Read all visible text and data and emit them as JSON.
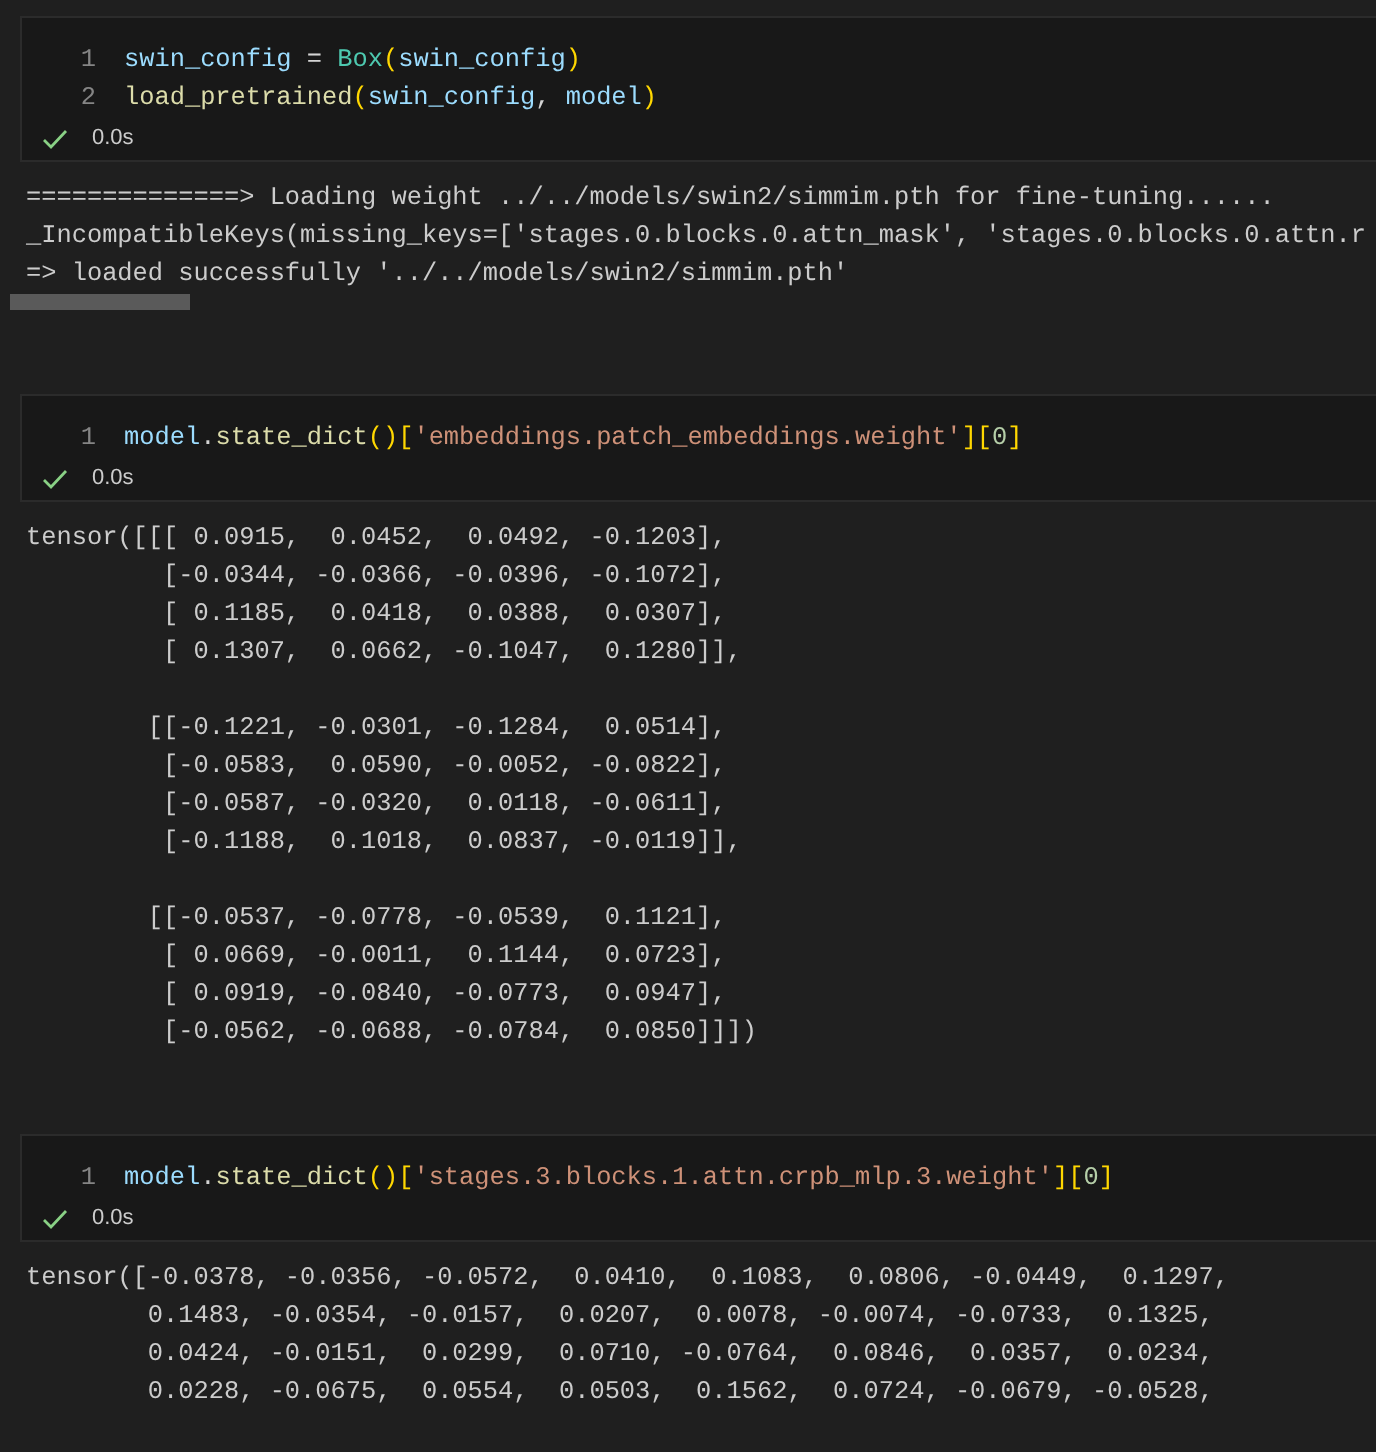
{
  "cells": [
    {
      "code": [
        {
          "number": "1",
          "tokens": [
            {
              "kind": "var",
              "text": "swin_config"
            },
            {
              "kind": "plain",
              "text": " = "
            },
            {
              "kind": "class",
              "text": "Box"
            },
            {
              "kind": "paren",
              "text": "("
            },
            {
              "kind": "var",
              "text": "swin_config"
            },
            {
              "kind": "paren",
              "text": ")"
            }
          ]
        },
        {
          "number": "2",
          "tokens": [
            {
              "kind": "func",
              "text": "load_pretrained"
            },
            {
              "kind": "paren",
              "text": "("
            },
            {
              "kind": "var",
              "text": "swin_config"
            },
            {
              "kind": "plain",
              "text": ", "
            },
            {
              "kind": "var",
              "text": "model"
            },
            {
              "kind": "paren",
              "text": ")"
            }
          ]
        }
      ],
      "status": {
        "succeeded": true,
        "time": "0.0s"
      },
      "output": {
        "scrollbar": true,
        "blocks": [
          [
            "==============> Loading weight ../../models/swin2/simmim.pth for fine-tuning......",
            "_IncompatibleKeys(missing_keys=['stages.0.blocks.0.attn_mask', 'stages.0.blocks.0.attn.r",
            "=> loaded successfully '../../models/swin2/simmim.pth'"
          ]
        ]
      }
    },
    {
      "code": [
        {
          "number": "1",
          "tokens": [
            {
              "kind": "var",
              "text": "model"
            },
            {
              "kind": "plain",
              "text": "."
            },
            {
              "kind": "func",
              "text": "state_dict"
            },
            {
              "kind": "paren",
              "text": "()"
            },
            {
              "kind": "paren",
              "text": "["
            },
            {
              "kind": "str",
              "text": "'embeddings.patch_embeddings.weight'"
            },
            {
              "kind": "paren",
              "text": "]["
            },
            {
              "kind": "num",
              "text": "0"
            },
            {
              "kind": "paren",
              "text": "]"
            }
          ]
        }
      ],
      "status": {
        "succeeded": true,
        "time": "0.0s"
      },
      "output": {
        "scrollbar": false,
        "blocks": [
          [
            "tensor([[[ 0.0915,  0.0452,  0.0492, -0.1203],",
            "         [-0.0344, -0.0366, -0.0396, -0.1072],",
            "         [ 0.1185,  0.0418,  0.0388,  0.0307],",
            "         [ 0.1307,  0.0662, -0.1047,  0.1280]],"
          ],
          [
            "        [[-0.1221, -0.0301, -0.1284,  0.0514],",
            "         [-0.0583,  0.0590, -0.0052, -0.0822],",
            "         [-0.0587, -0.0320,  0.0118, -0.0611],",
            "         [-0.1188,  0.1018,  0.0837, -0.0119]],"
          ],
          [
            "        [[-0.0537, -0.0778, -0.0539,  0.1121],",
            "         [ 0.0669, -0.0011,  0.1144,  0.0723],",
            "         [ 0.0919, -0.0840, -0.0773,  0.0947],",
            "         [-0.0562, -0.0688, -0.0784,  0.0850]]])"
          ]
        ]
      }
    },
    {
      "code": [
        {
          "number": "1",
          "tokens": [
            {
              "kind": "var",
              "text": "model"
            },
            {
              "kind": "plain",
              "text": "."
            },
            {
              "kind": "func",
              "text": "state_dict"
            },
            {
              "kind": "paren",
              "text": "()"
            },
            {
              "kind": "paren",
              "text": "["
            },
            {
              "kind": "str",
              "text": "'stages.3.blocks.1.attn.crpb_mlp.3.weight'"
            },
            {
              "kind": "paren",
              "text": "]["
            },
            {
              "kind": "num",
              "text": "0"
            },
            {
              "kind": "paren",
              "text": "]"
            }
          ]
        }
      ],
      "status": {
        "succeeded": true,
        "time": "0.0s"
      },
      "output": {
        "scrollbar": false,
        "blocks": [
          [
            "tensor([-0.0378, -0.0356, -0.0572,  0.0410,  0.1083,  0.0806, -0.0449,  0.1297,",
            "        0.1483, -0.0354, -0.0157,  0.0207,  0.0078, -0.0074, -0.0733,  0.1325,",
            "        0.0424, -0.0151,  0.0299,  0.0710, -0.0764,  0.0846,  0.0357,  0.0234,",
            "        0.0228, -0.0675,  0.0554,  0.0503,  0.1562,  0.0724, -0.0679, -0.0528,"
          ]
        ]
      }
    }
  ]
}
